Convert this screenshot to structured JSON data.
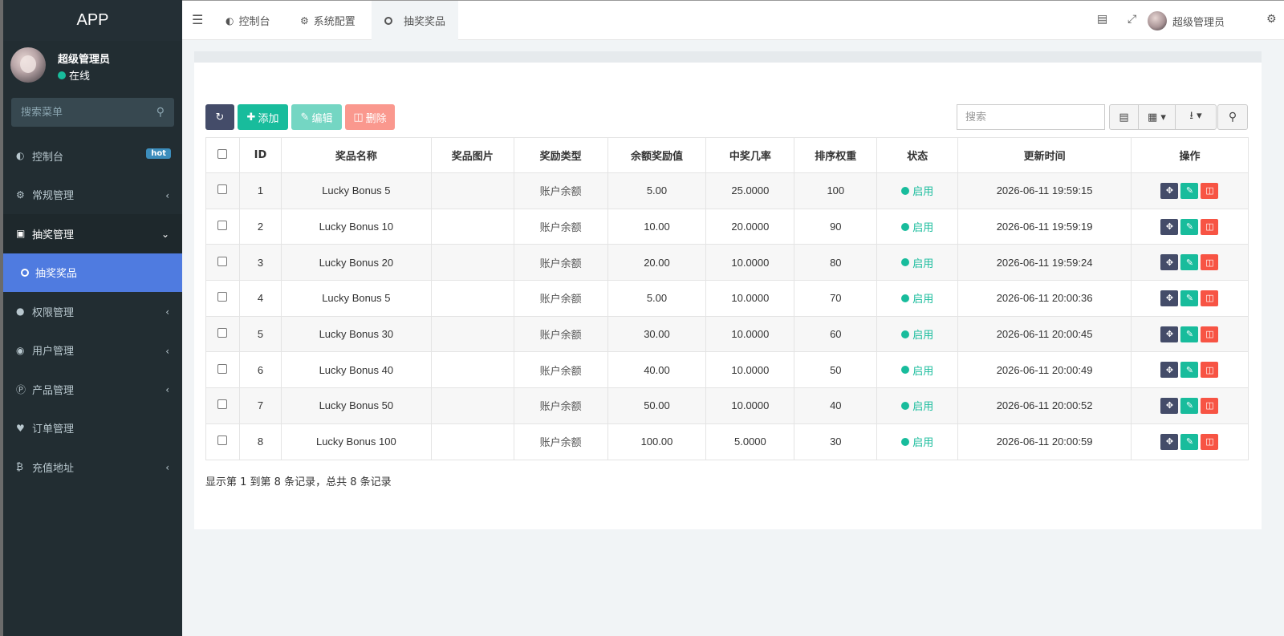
{
  "app": {
    "title": "APP"
  },
  "user": {
    "name": "超级管理员",
    "status": "在线"
  },
  "sidebar": {
    "search_placeholder": "搜索菜单",
    "items": [
      {
        "label": "控制台",
        "icon": "dashboard-icon",
        "badge": "hot"
      },
      {
        "label": "常规管理",
        "icon": "cogs-icon"
      },
      {
        "label": "抽奖管理",
        "icon": "gift-icon"
      },
      {
        "label": "抽奖奖品",
        "icon": "circle-icon"
      },
      {
        "label": "权限管理",
        "icon": "group-icon"
      },
      {
        "label": "用户管理",
        "icon": "user-circle-icon"
      },
      {
        "label": "产品管理",
        "icon": "product-icon"
      },
      {
        "label": "订单管理",
        "icon": "heartbeat-icon"
      },
      {
        "label": "充值地址",
        "icon": "bitcoin-icon"
      }
    ]
  },
  "topbar": {
    "tabs": [
      {
        "label": "控制台",
        "icon": "dashboard-icon"
      },
      {
        "label": "系统配置",
        "icon": "gear-icon"
      },
      {
        "label": "抽奖奖品",
        "icon": "circle-icon"
      }
    ],
    "user_name": "超级管理员"
  },
  "toolbar": {
    "add_label": "添加",
    "edit_label": "编辑",
    "delete_label": "删除",
    "search_placeholder": "搜索"
  },
  "table": {
    "columns": [
      "ID",
      "奖品名称",
      "奖品图片",
      "奖励类型",
      "余额奖励值",
      "中奖几率",
      "排序权重",
      "状态",
      "更新时间",
      "操作"
    ],
    "rows": [
      {
        "id": "1",
        "name": "Lucky Bonus 5",
        "image": "",
        "type": "账户余额",
        "amount": "5.00",
        "rate": "25.0000",
        "weight": "100",
        "status": "启用",
        "updated": "2026-06-11 19:59:15"
      },
      {
        "id": "2",
        "name": "Lucky Bonus 10",
        "image": "",
        "type": "账户余额",
        "amount": "10.00",
        "rate": "20.0000",
        "weight": "90",
        "status": "启用",
        "updated": "2026-06-11 19:59:19"
      },
      {
        "id": "3",
        "name": "Lucky Bonus 20",
        "image": "",
        "type": "账户余额",
        "amount": "20.00",
        "rate": "10.0000",
        "weight": "80",
        "status": "启用",
        "updated": "2026-06-11 19:59:24"
      },
      {
        "id": "4",
        "name": "Lucky Bonus 5",
        "image": "",
        "type": "账户余额",
        "amount": "5.00",
        "rate": "10.0000",
        "weight": "70",
        "status": "启用",
        "updated": "2026-06-11 20:00:36"
      },
      {
        "id": "5",
        "name": "Lucky Bonus 30",
        "image": "",
        "type": "账户余额",
        "amount": "30.00",
        "rate": "10.0000",
        "weight": "60",
        "status": "启用",
        "updated": "2026-06-11 20:00:45"
      },
      {
        "id": "6",
        "name": "Lucky Bonus 40",
        "image": "",
        "type": "账户余额",
        "amount": "40.00",
        "rate": "10.0000",
        "weight": "50",
        "status": "启用",
        "updated": "2026-06-11 20:00:49"
      },
      {
        "id": "7",
        "name": "Lucky Bonus 50",
        "image": "",
        "type": "账户余额",
        "amount": "50.00",
        "rate": "10.0000",
        "weight": "40",
        "status": "启用",
        "updated": "2026-06-11 20:00:52"
      },
      {
        "id": "8",
        "name": "Lucky Bonus 100",
        "image": "",
        "type": "账户余额",
        "amount": "100.00",
        "rate": "5.0000",
        "weight": "30",
        "status": "启用",
        "updated": "2026-06-11 20:00:59"
      }
    ]
  },
  "pagination": {
    "summary": "显示第 1 到第 8 条记录，总共 8 条记录"
  },
  "colors": {
    "primary": "#18bc9c",
    "danger": "#f75444",
    "dark": "#444c69",
    "sidebar": "#222d32",
    "active_menu": "#4f7be0"
  }
}
